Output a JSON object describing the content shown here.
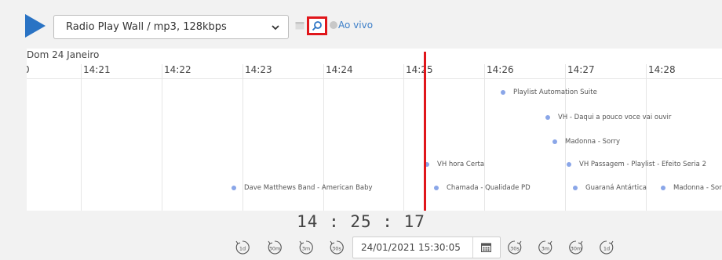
{
  "player": {
    "station": "Radio Play Wall / mp3, 128kbps",
    "live_label": "Ao vivo"
  },
  "timeline": {
    "date": "Dom 24 Janeiro",
    "hours": [
      "0",
      "14:21",
      "14:22",
      "14:23",
      "14:24",
      "14:25",
      "14:26",
      "14:27",
      "14:28"
    ],
    "events": [
      "Playlist Automation Suite",
      "VH - Daqui a pouco voce vai ouvir",
      "Madonna - Sorry",
      "VH hora Certa",
      "VH Passagem - Playlist - Efeito Seria 2",
      "Dave Matthews Band - American Baby",
      "Chamada - Qualidade PD",
      "Guaraná Antártica",
      "Madonna - Sorry"
    ]
  },
  "clock": "14 : 25 : 17",
  "navigation": {
    "back": [
      "1d",
      "30m",
      "3m",
      "30s"
    ],
    "forward": [
      "30s",
      "3m",
      "30m",
      "1d"
    ],
    "datetime_value": "24/01/2021 15:30:05"
  },
  "colors": {
    "accent_blue": "#2a73c4",
    "cursor_red": "#e0161b",
    "event_dot": "#8aa6e8"
  }
}
